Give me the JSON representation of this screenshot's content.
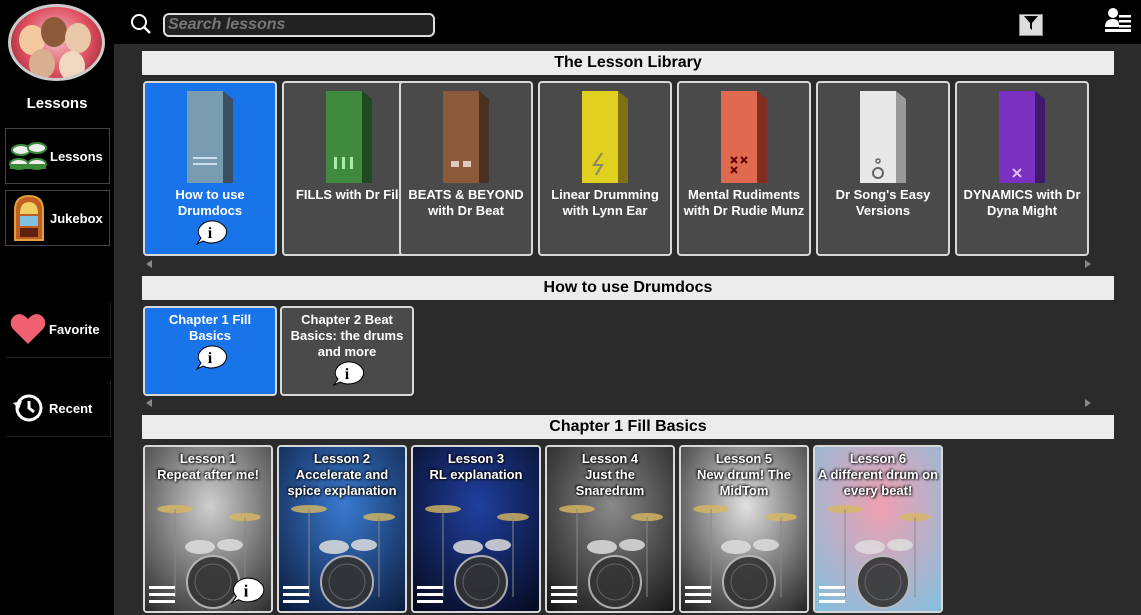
{
  "sidebar": {
    "title": "Lessons",
    "buttons": [
      {
        "label": "Lessons",
        "icon": "drums-icon"
      },
      {
        "label": "Jukebox",
        "icon": "jukebox-icon"
      },
      {
        "label": "Favorite",
        "icon": "heart-icon"
      },
      {
        "label": "Recent",
        "icon": "history-icon"
      }
    ]
  },
  "search": {
    "placeholder": "Search lessons",
    "value": ""
  },
  "library": {
    "title": "The Lesson Library",
    "books": [
      {
        "label": "How to use Drumdocs",
        "color": "#7a9cb0",
        "active": true
      },
      {
        "label": "FILLS with Dr Fill",
        "color": "#3f8a3f"
      },
      {
        "label": "BEATS & BEYOND with Dr Beat",
        "color": "#8a5a3a"
      },
      {
        "label": "Linear Drumming with Lynn Ear",
        "color": "#e0d020"
      },
      {
        "label": "Mental Rudiments with Dr Rudie Munz",
        "color": "#e06a50"
      },
      {
        "label": "Dr Song's Easy Versions",
        "color": "#e0e0e0"
      },
      {
        "label": "DYNAMICS with Dr Dyna Might",
        "color": "#7a30c0"
      }
    ]
  },
  "howto": {
    "title": "How to use Drumdocs",
    "chapters": [
      {
        "label": "Chapter 1 Fill Basics",
        "active": true
      },
      {
        "label": "Chapter 2 Beat Basics: the drums and more"
      }
    ]
  },
  "chapter1": {
    "title": "Chapter 1 Fill Basics",
    "lessons": [
      {
        "title": "Lesson 1",
        "subtitle": "Repeat after me!"
      },
      {
        "title": "Lesson 2",
        "subtitle": "Accelerate and spice explanation"
      },
      {
        "title": "Lesson 3",
        "subtitle": "RL explanation"
      },
      {
        "title": "Lesson 4",
        "subtitle": "Just the Snaredrum"
      },
      {
        "title": "Lesson 5",
        "subtitle": "New drum! The MidTom"
      },
      {
        "title": "Lesson 6",
        "subtitle": "A different drum on every beat!"
      }
    ]
  },
  "colors": {
    "accent": "#1874e8",
    "panel": "#2b2b2b",
    "tile": "#4a4a4a"
  }
}
